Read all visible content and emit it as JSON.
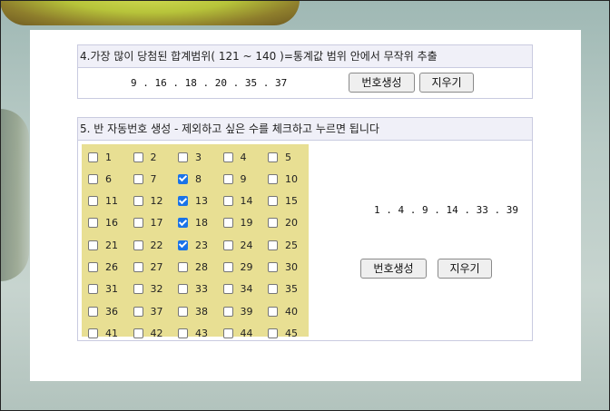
{
  "section4": {
    "title": "4.가장 많이 당첨된 합계범위( 121 ~ 140 )=통계값 범위 안에서 무작위 추출",
    "numbers": "9 . 16 . 18 . 20 . 35 . 37",
    "generate_label": "번호생성",
    "clear_label": "지우기"
  },
  "section5": {
    "title": "5. 반 자동번호 생성 - 제외하고 싶은 수를 체크하고 누르면 됩니다",
    "numbers": "1 . 4 . 9 . 14 . 33 . 39",
    "generate_label": "번호생성",
    "clear_label": "지우기",
    "checkboxes": [
      {
        "label": "1",
        "checked": false
      },
      {
        "label": "2",
        "checked": false
      },
      {
        "label": "3",
        "checked": false
      },
      {
        "label": "4",
        "checked": false
      },
      {
        "label": "5",
        "checked": false
      },
      {
        "label": "6",
        "checked": false
      },
      {
        "label": "7",
        "checked": false
      },
      {
        "label": "8",
        "checked": true
      },
      {
        "label": "9",
        "checked": false
      },
      {
        "label": "10",
        "checked": false
      },
      {
        "label": "11",
        "checked": false
      },
      {
        "label": "12",
        "checked": false
      },
      {
        "label": "13",
        "checked": true
      },
      {
        "label": "14",
        "checked": false
      },
      {
        "label": "15",
        "checked": false
      },
      {
        "label": "16",
        "checked": false
      },
      {
        "label": "17",
        "checked": false
      },
      {
        "label": "18",
        "checked": true
      },
      {
        "label": "19",
        "checked": false
      },
      {
        "label": "20",
        "checked": false
      },
      {
        "label": "21",
        "checked": false
      },
      {
        "label": "22",
        "checked": false
      },
      {
        "label": "23",
        "checked": true
      },
      {
        "label": "24",
        "checked": false
      },
      {
        "label": "25",
        "checked": false
      },
      {
        "label": "26",
        "checked": false
      },
      {
        "label": "27",
        "checked": false
      },
      {
        "label": "28",
        "checked": false
      },
      {
        "label": "29",
        "checked": false
      },
      {
        "label": "30",
        "checked": false
      },
      {
        "label": "31",
        "checked": false
      },
      {
        "label": "32",
        "checked": false
      },
      {
        "label": "33",
        "checked": false
      },
      {
        "label": "34",
        "checked": false
      },
      {
        "label": "35",
        "checked": false
      },
      {
        "label": "36",
        "checked": false
      },
      {
        "label": "37",
        "checked": false
      },
      {
        "label": "38",
        "checked": false
      },
      {
        "label": "39",
        "checked": false
      },
      {
        "label": "40",
        "checked": false
      },
      {
        "label": "41",
        "checked": false
      },
      {
        "label": "42",
        "checked": false
      },
      {
        "label": "43",
        "checked": false
      },
      {
        "label": "44",
        "checked": false
      },
      {
        "label": "45",
        "checked": false
      }
    ],
    "grid_color": "#e8df93",
    "check_color": "#1a73e8"
  }
}
